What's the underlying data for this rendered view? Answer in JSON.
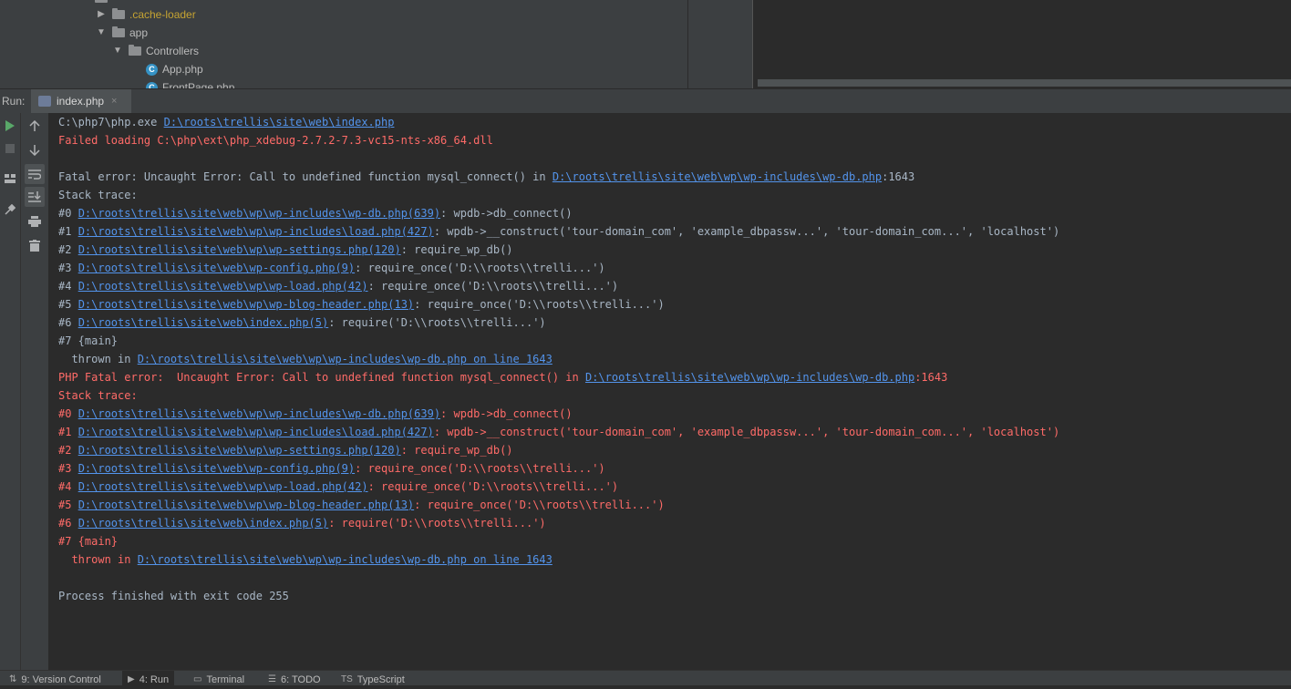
{
  "project_tree": {
    "items": [
      {
        "label": ".cache-loader",
        "arrow": "▶"
      },
      {
        "label": "app",
        "arrow": "▼"
      },
      {
        "label": "Controllers",
        "arrow": "▼"
      },
      {
        "label": "App.php",
        "icon": "C"
      },
      {
        "label": "FrontPage.php",
        "icon": "C"
      }
    ]
  },
  "run_panel": {
    "label": "Run:",
    "tab": {
      "label": "index.php",
      "close": "×"
    }
  },
  "console": {
    "lines": [
      {
        "text": "C:\\php7\\php.exe ",
        "link": "D:\\roots\\trellis\\site\\web\\index.php",
        "tail": "",
        "err": false
      },
      {
        "text": "Failed loading C:\\php\\ext\\php_xdebug-2.7.2-7.3-vc15-nts-x86_64.dll",
        "link": "",
        "tail": "",
        "err": true
      },
      {
        "text": "",
        "link": "",
        "tail": "",
        "err": false
      },
      {
        "text": "Fatal error: Uncaught Error: Call to undefined function mysql_connect() in ",
        "link": "D:\\roots\\trellis\\site\\web\\wp\\wp-includes\\wp-db.php",
        "tail": ":1643",
        "err": false
      },
      {
        "text": "Stack trace:",
        "link": "",
        "tail": "",
        "err": false
      },
      {
        "text": "#0 ",
        "link": "D:\\roots\\trellis\\site\\web\\wp\\wp-includes\\wp-db.php(639)",
        "tail": ": wpdb->db_connect()",
        "err": false
      },
      {
        "text": "#1 ",
        "link": "D:\\roots\\trellis\\site\\web\\wp\\wp-includes\\load.php(427)",
        "tail": ": wpdb->__construct('tour-domain_com', 'example_dbpassw...', 'tour-domain_com...', 'localhost')",
        "err": false
      },
      {
        "text": "#2 ",
        "link": "D:\\roots\\trellis\\site\\web\\wp\\wp-settings.php(120)",
        "tail": ": require_wp_db()",
        "err": false
      },
      {
        "text": "#3 ",
        "link": "D:\\roots\\trellis\\site\\web\\wp-config.php(9)",
        "tail": ": require_once('D:\\\\roots\\\\trelli...')",
        "err": false
      },
      {
        "text": "#4 ",
        "link": "D:\\roots\\trellis\\site\\web\\wp\\wp-load.php(42)",
        "tail": ": require_once('D:\\\\roots\\\\trelli...')",
        "err": false
      },
      {
        "text": "#5 ",
        "link": "D:\\roots\\trellis\\site\\web\\wp\\wp-blog-header.php(13)",
        "tail": ": require_once('D:\\\\roots\\\\trelli...')",
        "err": false
      },
      {
        "text": "#6 ",
        "link": "D:\\roots\\trellis\\site\\web\\index.php(5)",
        "tail": ": require('D:\\\\roots\\\\trelli...')",
        "err": false
      },
      {
        "text": "#7 {main}",
        "link": "",
        "tail": "",
        "err": false
      },
      {
        "text": "  thrown in ",
        "link": "D:\\roots\\trellis\\site\\web\\wp\\wp-includes\\wp-db.php on line 1643",
        "tail": "",
        "err": false
      },
      {
        "text": "PHP Fatal error:  Uncaught Error: Call to undefined function mysql_connect() in ",
        "link": "D:\\roots\\trellis\\site\\web\\wp\\wp-includes\\wp-db.php",
        "tail": ":1643",
        "err": true
      },
      {
        "text": "Stack trace:",
        "link": "",
        "tail": "",
        "err": true
      },
      {
        "text": "#0 ",
        "link": "D:\\roots\\trellis\\site\\web\\wp\\wp-includes\\wp-db.php(639)",
        "tail": ": wpdb->db_connect()",
        "err": true
      },
      {
        "text": "#1 ",
        "link": "D:\\roots\\trellis\\site\\web\\wp\\wp-includes\\load.php(427)",
        "tail": ": wpdb->__construct('tour-domain_com', 'example_dbpassw...', 'tour-domain_com...', 'localhost')",
        "err": true
      },
      {
        "text": "#2 ",
        "link": "D:\\roots\\trellis\\site\\web\\wp\\wp-settings.php(120)",
        "tail": ": require_wp_db()",
        "err": true
      },
      {
        "text": "#3 ",
        "link": "D:\\roots\\trellis\\site\\web\\wp-config.php(9)",
        "tail": ": require_once('D:\\\\roots\\\\trelli...')",
        "err": true
      },
      {
        "text": "#4 ",
        "link": "D:\\roots\\trellis\\site\\web\\wp\\wp-load.php(42)",
        "tail": ": require_once('D:\\\\roots\\\\trelli...')",
        "err": true
      },
      {
        "text": "#5 ",
        "link": "D:\\roots\\trellis\\site\\web\\wp\\wp-blog-header.php(13)",
        "tail": ": require_once('D:\\\\roots\\\\trelli...')",
        "err": true
      },
      {
        "text": "#6 ",
        "link": "D:\\roots\\trellis\\site\\web\\index.php(5)",
        "tail": ": require('D:\\\\roots\\\\trelli...')",
        "err": true
      },
      {
        "text": "#7 {main}",
        "link": "",
        "tail": "",
        "err": true
      },
      {
        "text": "  thrown in ",
        "link": "D:\\roots\\trellis\\site\\web\\wp\\wp-includes\\wp-db.php on line 1643",
        "tail": "",
        "err": true
      },
      {
        "text": "",
        "link": "",
        "tail": "",
        "err": false
      },
      {
        "text": "Process finished with exit code 255",
        "link": "",
        "tail": "",
        "err": false
      }
    ]
  },
  "bottom_tabs": [
    {
      "icon": "⇅",
      "label": "9: Version Control",
      "active": false
    },
    {
      "icon": "▶",
      "label": "4: Run",
      "active": true
    },
    {
      "icon": "▭",
      "label": "Terminal",
      "active": false
    },
    {
      "icon": "☰",
      "label": "6: TODO",
      "active": false
    },
    {
      "icon": "TS",
      "label": "TypeScript",
      "active": false
    }
  ],
  "colors": {
    "error_text": "#ff6b68",
    "link": "#5394ec",
    "console_bg": "#2b2b2b",
    "panel_bg": "#3c3f41"
  }
}
